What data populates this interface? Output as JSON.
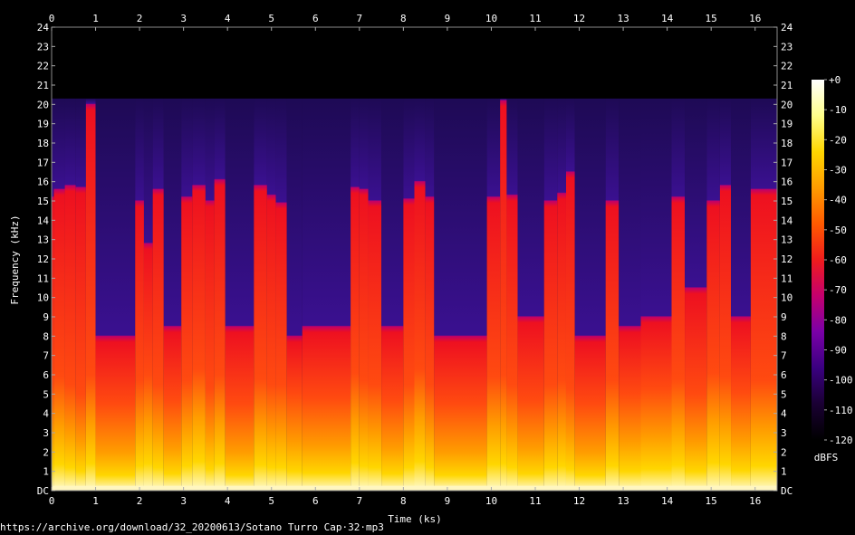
{
  "chart_data": {
    "type": "heatmap",
    "xlabel": "Time (ks)",
    "ylabel": "Frequency (kHz)",
    "xlim": [
      0,
      16.5
    ],
    "ylim": [
      0,
      24
    ],
    "x_ticks": [
      "0",
      "1",
      "2",
      "3",
      "4",
      "5",
      "6",
      "7",
      "8",
      "9",
      "10",
      "11",
      "12",
      "13",
      "14",
      "15",
      "16"
    ],
    "y_ticks": [
      "DC",
      "1",
      "2",
      "3",
      "4",
      "5",
      "6",
      "7",
      "8",
      "9",
      "10",
      "11",
      "12",
      "13",
      "14",
      "15",
      "16",
      "17",
      "18",
      "19",
      "20",
      "21",
      "22",
      "23",
      "24"
    ],
    "colorbar": {
      "label": "dBFS",
      "ticks": [
        "+0",
        "-10",
        "-20",
        "-30",
        "-40",
        "-50",
        "-60",
        "-70",
        "-80",
        "-90",
        "-100",
        "-110",
        "-120"
      ],
      "range": [
        -120,
        0
      ],
      "colors": [
        "#000000",
        "#1a0033",
        "#3a0080",
        "#7a00a8",
        "#c4006e",
        "#f01c1c",
        "#ff5a00",
        "#ff9c00",
        "#ffd600",
        "#ffff8a",
        "#ffffff"
      ]
    },
    "segments": [
      {
        "t0": 0.0,
        "t1": 0.05,
        "music_top_khz": 15.2,
        "bright_top_khz": 3.0
      },
      {
        "t0": 0.05,
        "t1": 0.3,
        "music_top_khz": 15.6,
        "bright_top_khz": 3.4
      },
      {
        "t0": 0.3,
        "t1": 0.55,
        "music_top_khz": 15.8,
        "bright_top_khz": 3.0
      },
      {
        "t0": 0.55,
        "t1": 0.78,
        "music_top_khz": 15.7,
        "bright_top_khz": 2.5
      },
      {
        "t0": 0.78,
        "t1": 1.0,
        "music_top_khz": 20.0,
        "bright_top_khz": 3.5
      },
      {
        "t0": 1.0,
        "t1": 1.9,
        "music_top_khz": 8.0,
        "bright_top_khz": 2.0
      },
      {
        "t0": 1.9,
        "t1": 2.1,
        "music_top_khz": 15.0,
        "bright_top_khz": 3.2
      },
      {
        "t0": 2.1,
        "t1": 2.3,
        "music_top_khz": 12.8,
        "bright_top_khz": 3.5
      },
      {
        "t0": 2.3,
        "t1": 2.55,
        "music_top_khz": 15.6,
        "bright_top_khz": 3.0
      },
      {
        "t0": 2.55,
        "t1": 2.95,
        "music_top_khz": 8.5,
        "bright_top_khz": 2.2
      },
      {
        "t0": 2.95,
        "t1": 3.2,
        "music_top_khz": 15.2,
        "bright_top_khz": 3.2
      },
      {
        "t0": 3.2,
        "t1": 3.5,
        "music_top_khz": 15.8,
        "bright_top_khz": 3.8
      },
      {
        "t0": 3.5,
        "t1": 3.7,
        "music_top_khz": 15.0,
        "bright_top_khz": 2.8
      },
      {
        "t0": 3.7,
        "t1": 3.95,
        "music_top_khz": 16.1,
        "bright_top_khz": 3.5
      },
      {
        "t0": 3.95,
        "t1": 4.6,
        "music_top_khz": 8.5,
        "bright_top_khz": 2.0
      },
      {
        "t0": 4.6,
        "t1": 4.9,
        "music_top_khz": 15.8,
        "bright_top_khz": 3.3
      },
      {
        "t0": 4.9,
        "t1": 5.1,
        "music_top_khz": 15.3,
        "bright_top_khz": 3.0
      },
      {
        "t0": 5.1,
        "t1": 5.35,
        "music_top_khz": 14.9,
        "bright_top_khz": 3.0
      },
      {
        "t0": 5.35,
        "t1": 5.7,
        "music_top_khz": 8.0,
        "bright_top_khz": 2.5
      },
      {
        "t0": 5.7,
        "t1": 6.8,
        "music_top_khz": 8.5,
        "bright_top_khz": 2.3
      },
      {
        "t0": 6.8,
        "t1": 7.0,
        "music_top_khz": 15.7,
        "bright_top_khz": 3.6
      },
      {
        "t0": 7.0,
        "t1": 7.2,
        "music_top_khz": 15.6,
        "bright_top_khz": 3.2
      },
      {
        "t0": 7.2,
        "t1": 7.5,
        "music_top_khz": 15.0,
        "bright_top_khz": 3.0
      },
      {
        "t0": 7.5,
        "t1": 8.0,
        "music_top_khz": 8.5,
        "bright_top_khz": 2.2
      },
      {
        "t0": 8.0,
        "t1": 8.25,
        "music_top_khz": 15.1,
        "bright_top_khz": 3.0
      },
      {
        "t0": 8.25,
        "t1": 8.5,
        "music_top_khz": 16.0,
        "bright_top_khz": 3.8
      },
      {
        "t0": 8.5,
        "t1": 8.7,
        "music_top_khz": 15.2,
        "bright_top_khz": 3.0
      },
      {
        "t0": 8.7,
        "t1": 9.9,
        "music_top_khz": 8.0,
        "bright_top_khz": 2.0
      },
      {
        "t0": 9.9,
        "t1": 10.2,
        "music_top_khz": 15.2,
        "bright_top_khz": 3.4
      },
      {
        "t0": 10.2,
        "t1": 10.35,
        "music_top_khz": 20.2,
        "bright_top_khz": 3.5
      },
      {
        "t0": 10.35,
        "t1": 10.6,
        "music_top_khz": 15.3,
        "bright_top_khz": 3.0
      },
      {
        "t0": 10.6,
        "t1": 11.2,
        "music_top_khz": 9.0,
        "bright_top_khz": 2.2
      },
      {
        "t0": 11.2,
        "t1": 11.5,
        "music_top_khz": 15.0,
        "bright_top_khz": 3.0
      },
      {
        "t0": 11.5,
        "t1": 11.7,
        "music_top_khz": 15.4,
        "bright_top_khz": 3.2
      },
      {
        "t0": 11.7,
        "t1": 11.9,
        "music_top_khz": 16.5,
        "bright_top_khz": 2.8
      },
      {
        "t0": 11.9,
        "t1": 12.6,
        "music_top_khz": 8.0,
        "bright_top_khz": 2.0
      },
      {
        "t0": 12.6,
        "t1": 12.9,
        "music_top_khz": 15.0,
        "bright_top_khz": 3.2
      },
      {
        "t0": 12.9,
        "t1": 13.4,
        "music_top_khz": 8.5,
        "bright_top_khz": 2.5
      },
      {
        "t0": 13.4,
        "t1": 14.1,
        "music_top_khz": 9.0,
        "bright_top_khz": 2.8
      },
      {
        "t0": 14.1,
        "t1": 14.4,
        "music_top_khz": 15.2,
        "bright_top_khz": 3.3
      },
      {
        "t0": 14.4,
        "t1": 14.9,
        "music_top_khz": 10.5,
        "bright_top_khz": 2.5
      },
      {
        "t0": 14.9,
        "t1": 15.2,
        "music_top_khz": 15.0,
        "bright_top_khz": 3.6
      },
      {
        "t0": 15.2,
        "t1": 15.45,
        "music_top_khz": 15.8,
        "bright_top_khz": 3.4
      },
      {
        "t0": 15.45,
        "t1": 15.9,
        "music_top_khz": 9.0,
        "bright_top_khz": 2.6
      },
      {
        "t0": 15.9,
        "t1": 16.5,
        "music_top_khz": 15.6,
        "bright_top_khz": 3.2
      }
    ]
  },
  "source": "https://archive.org/download/32_20200613/Sotano Turro Cap·32·mp3"
}
